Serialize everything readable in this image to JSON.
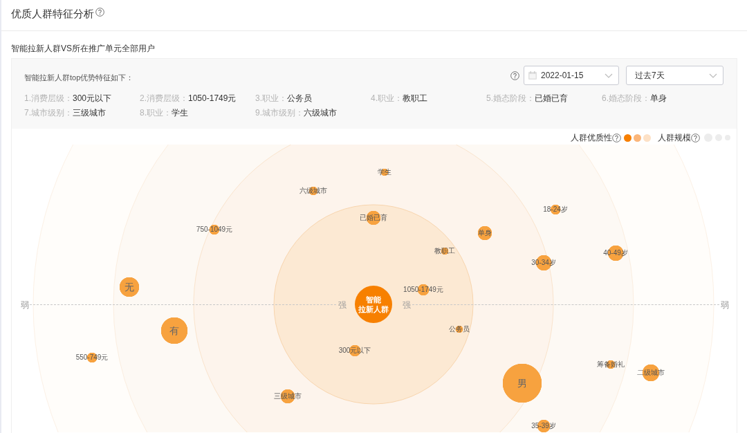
{
  "header": {
    "title": "优质人群特征分析"
  },
  "subtitle": "智能拉新人群VS所在推广单元全部用户",
  "panel": {
    "title": "智能拉新人群top优势特征如下：",
    "date_picker": {
      "value": "2022-01-15"
    },
    "period_select": {
      "value": "过去7天"
    },
    "features": [
      {
        "label": "1.消费层级：",
        "value": "300元以下"
      },
      {
        "label": "2.消费层级：",
        "value": "1050-1749元"
      },
      {
        "label": "3.职业：",
        "value": "公务员"
      },
      {
        "label": "4.职业：",
        "value": "教职工"
      },
      {
        "label": "5.婚态阶段：",
        "value": "已婚已育"
      },
      {
        "label": "6.婚态阶段：",
        "value": "单身"
      },
      {
        "label": "7.城市级别：",
        "value": "三级城市"
      },
      {
        "label": "8.职业：",
        "value": "学生"
      },
      {
        "label": "9.城市级别：",
        "value": "六级城市"
      }
    ]
  },
  "chart": {
    "legend": {
      "quality_label": "人群优质性",
      "quality_swatches": [
        {
          "color": "#f77f00"
        },
        {
          "color": "#fbb67a"
        },
        {
          "color": "#fde1c6"
        }
      ],
      "scale_label": "人群规模"
    },
    "axis_labels": [
      "弱",
      "强",
      "强",
      "弱"
    ],
    "center_bubble": {
      "lines": [
        "智能",
        "拉新人群"
      ]
    },
    "bubbles": [
      {
        "label": "学生"
      },
      {
        "label": "六级城市"
      },
      {
        "label": "18-24岁"
      },
      {
        "label": "已婚已育"
      },
      {
        "label": "750-1049元"
      },
      {
        "label": "单身"
      },
      {
        "label": "教职工"
      },
      {
        "label": "40-49岁"
      },
      {
        "label": "30-34岁"
      },
      {
        "label": "无"
      },
      {
        "label": "1050-1749元"
      },
      {
        "label": "公务员"
      },
      {
        "label": "有"
      },
      {
        "label": "300元以下"
      },
      {
        "label": "550-749元"
      },
      {
        "label": "筹备婚礼"
      },
      {
        "label": "二级城市"
      },
      {
        "label": "男"
      },
      {
        "label": "三级城市"
      },
      {
        "label": "35-39岁"
      }
    ]
  }
}
